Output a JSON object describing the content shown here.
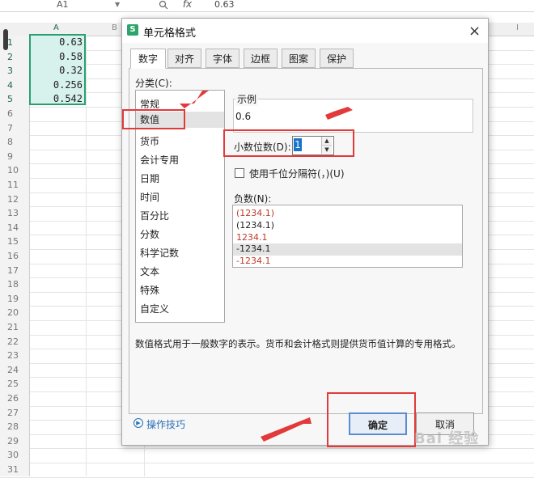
{
  "spreadsheet": {
    "name_box": "A1",
    "zoom_icon": "magnifier-icon",
    "fx_label": "fx",
    "formula_value": "0.63",
    "columns": [
      "A",
      "B",
      "I"
    ],
    "rows": [
      "1",
      "2",
      "3",
      "4",
      "5",
      "6",
      "7",
      "8",
      "9",
      "10",
      "11",
      "12",
      "13",
      "14",
      "15",
      "16",
      "17",
      "18",
      "19",
      "20",
      "21",
      "22",
      "23",
      "24",
      "25",
      "26",
      "27",
      "28",
      "29",
      "30",
      "31"
    ],
    "cells_a": [
      "0.63",
      "0.58",
      "0.32",
      "0.256",
      "0.542"
    ]
  },
  "dialog": {
    "title": "单元格格式",
    "app_icon_letter": "S",
    "close_glyph": "×",
    "tabs": [
      "数字",
      "对齐",
      "字体",
      "边框",
      "图案",
      "保护"
    ],
    "category_label": "分类(C):",
    "categories": [
      "常规",
      "数值",
      "货币",
      "会计专用",
      "日期",
      "时间",
      "百分比",
      "分数",
      "科学记数",
      "文本",
      "特殊",
      "自定义"
    ],
    "selected_category": "数值",
    "sample_label": "示例",
    "sample_value": "0.6",
    "decimal_label": "小数位数(D):",
    "decimal_value": "1",
    "thousands_label": "使用千位分隔符(，)(U)",
    "negative_label": "负数(N):",
    "negative_options": [
      "(1234.1)",
      "(1234.1)",
      "1234.1",
      "-1234.1",
      "-1234.1"
    ],
    "description": "数值格式用于一般数字的表示。货币和会计格式则提供货币值计算的专用格式。",
    "tips_label": "操作技巧",
    "ok_label": "确定",
    "cancel_label": "取消"
  },
  "watermark": "Bai 经验",
  "colors": {
    "selection_border": "#2aa071",
    "selection_fill": "#d7f1ec",
    "annotation_red": "#e23a3a",
    "negative_red": "#c0392b",
    "link_blue": "#2a6fb8"
  }
}
